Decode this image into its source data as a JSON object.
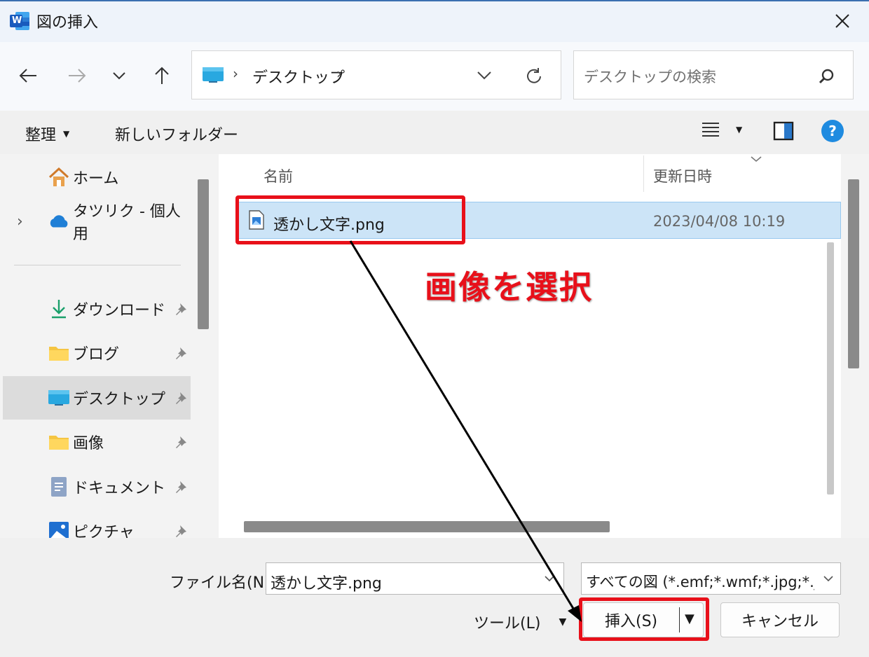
{
  "window": {
    "title": "図の挿入",
    "app_icon_letter": "W"
  },
  "nav": {
    "path": [
      "デスクトップ"
    ],
    "search_placeholder": "デスクトップの検索"
  },
  "toolbar": {
    "organize": "整理",
    "new_folder": "新しいフォルダー"
  },
  "sidebar": {
    "items": [
      {
        "label": "ホーム",
        "icon": "home-icon"
      },
      {
        "label": "タツリク - 個人用",
        "icon": "cloud-icon"
      },
      {
        "label": "ダウンロード",
        "icon": "download-icon",
        "pinned": true
      },
      {
        "label": "ブログ",
        "icon": "folder-icon",
        "pinned": true
      },
      {
        "label": "デスクトップ",
        "icon": "desktop-icon",
        "pinned": true,
        "selected": true
      },
      {
        "label": "画像",
        "icon": "folder-icon",
        "pinned": true
      },
      {
        "label": "ドキュメント",
        "icon": "document-icon",
        "pinned": true
      },
      {
        "label": "ピクチャ",
        "icon": "pictures-icon",
        "pinned": true
      }
    ]
  },
  "file_list": {
    "columns": [
      "名前",
      "更新日時"
    ],
    "rows": [
      {
        "name": "透かし文字.png",
        "modified": "2023/04/08 10:19"
      }
    ]
  },
  "annotation": {
    "text": "画像を選択",
    "color": "#e8101a"
  },
  "bottom": {
    "filename_label": "ファイル名(N):",
    "filename_value": "透かし文字.png",
    "filter_value": "すべての図 (*.emf;*.wmf;*.jpg;*.jp",
    "tools_label": "ツール(L)",
    "insert_label": "挿入(S)",
    "cancel_label": "キャンセル"
  }
}
